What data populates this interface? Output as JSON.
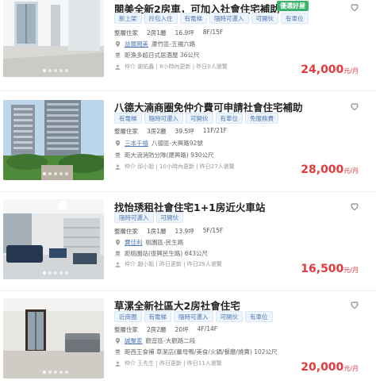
{
  "listings": [
    {
      "title": "閱美全新2房車，可加入社會住宅補助",
      "badge": "優選好屋",
      "tags": [
        "新上架",
        "拎包入住",
        "有電梯",
        "隨時可遷入",
        "可開伙",
        "有車位"
      ],
      "specs": [
        "整層住家",
        "2房1廳",
        "16.9坪",
        "8F/15F"
      ],
      "community": "益展閱美",
      "address": "蘆竹區-五福六路",
      "distance": "距漁多超日式居酒屋 36公尺",
      "poster": "仲介 謝佑鑫 | 8小時內更新 | 昨日0人瀏覽",
      "price": "24,000",
      "price_unit": "元/月"
    },
    {
      "title": "八德大湳商圈免仲介費可申請社會住宅補助",
      "badge": "",
      "tags": [
        "有電梯",
        "隨時可遷入",
        "可開伙",
        "有車位",
        "免服務費"
      ],
      "specs": [
        "整層住家",
        "3房2廳",
        "39.5坪",
        "11F/21F"
      ],
      "community": "三本千禧",
      "address": "八德區-大興路92號",
      "distance": "距大湳消防分隊(建興路) 930公尺",
      "poster": "仲介 邱小姐 | 10小時內更新 | 昨日27人瀏覽",
      "price": "28,000",
      "price_unit": "元/月"
    },
    {
      "title": "找怡琇租社會住宅1+1房近火車站",
      "badge": "",
      "tags": [
        "隨時可遷入",
        "可開伙"
      ],
      "specs": [
        "整層住家",
        "1房1廳",
        "13.9坪",
        "5F/15F"
      ],
      "community": "寶佳利",
      "address": "桃園區-民生路",
      "distance": "距桃園站(復興民生路) 643公尺",
      "poster": "仲介 趙小姐 | 昨日更新 | 昨日29人瀏覽",
      "price": "16,500",
      "price_unit": "元/月"
    },
    {
      "title": "草漯全新社區大2房社會住宅",
      "badge": "",
      "tags": [
        "近商圈",
        "有電梯",
        "隨時可遷入",
        "可開伙",
        "有車位"
      ],
      "specs": [
        "整層住家",
        "2房2廳",
        "20坪",
        "4F/14F"
      ],
      "community": "誠聚家",
      "address": "觀音區-大觀路二段",
      "distance": "距西王食補 草潔店(薑母鴨/美食/火鍋/餐廳/燒賣) 102公尺",
      "poster": "仲介 王先生 | 昨日更新 | 昨日11人瀏覽",
      "price": "20,000",
      "price_unit": "元/月"
    }
  ]
}
